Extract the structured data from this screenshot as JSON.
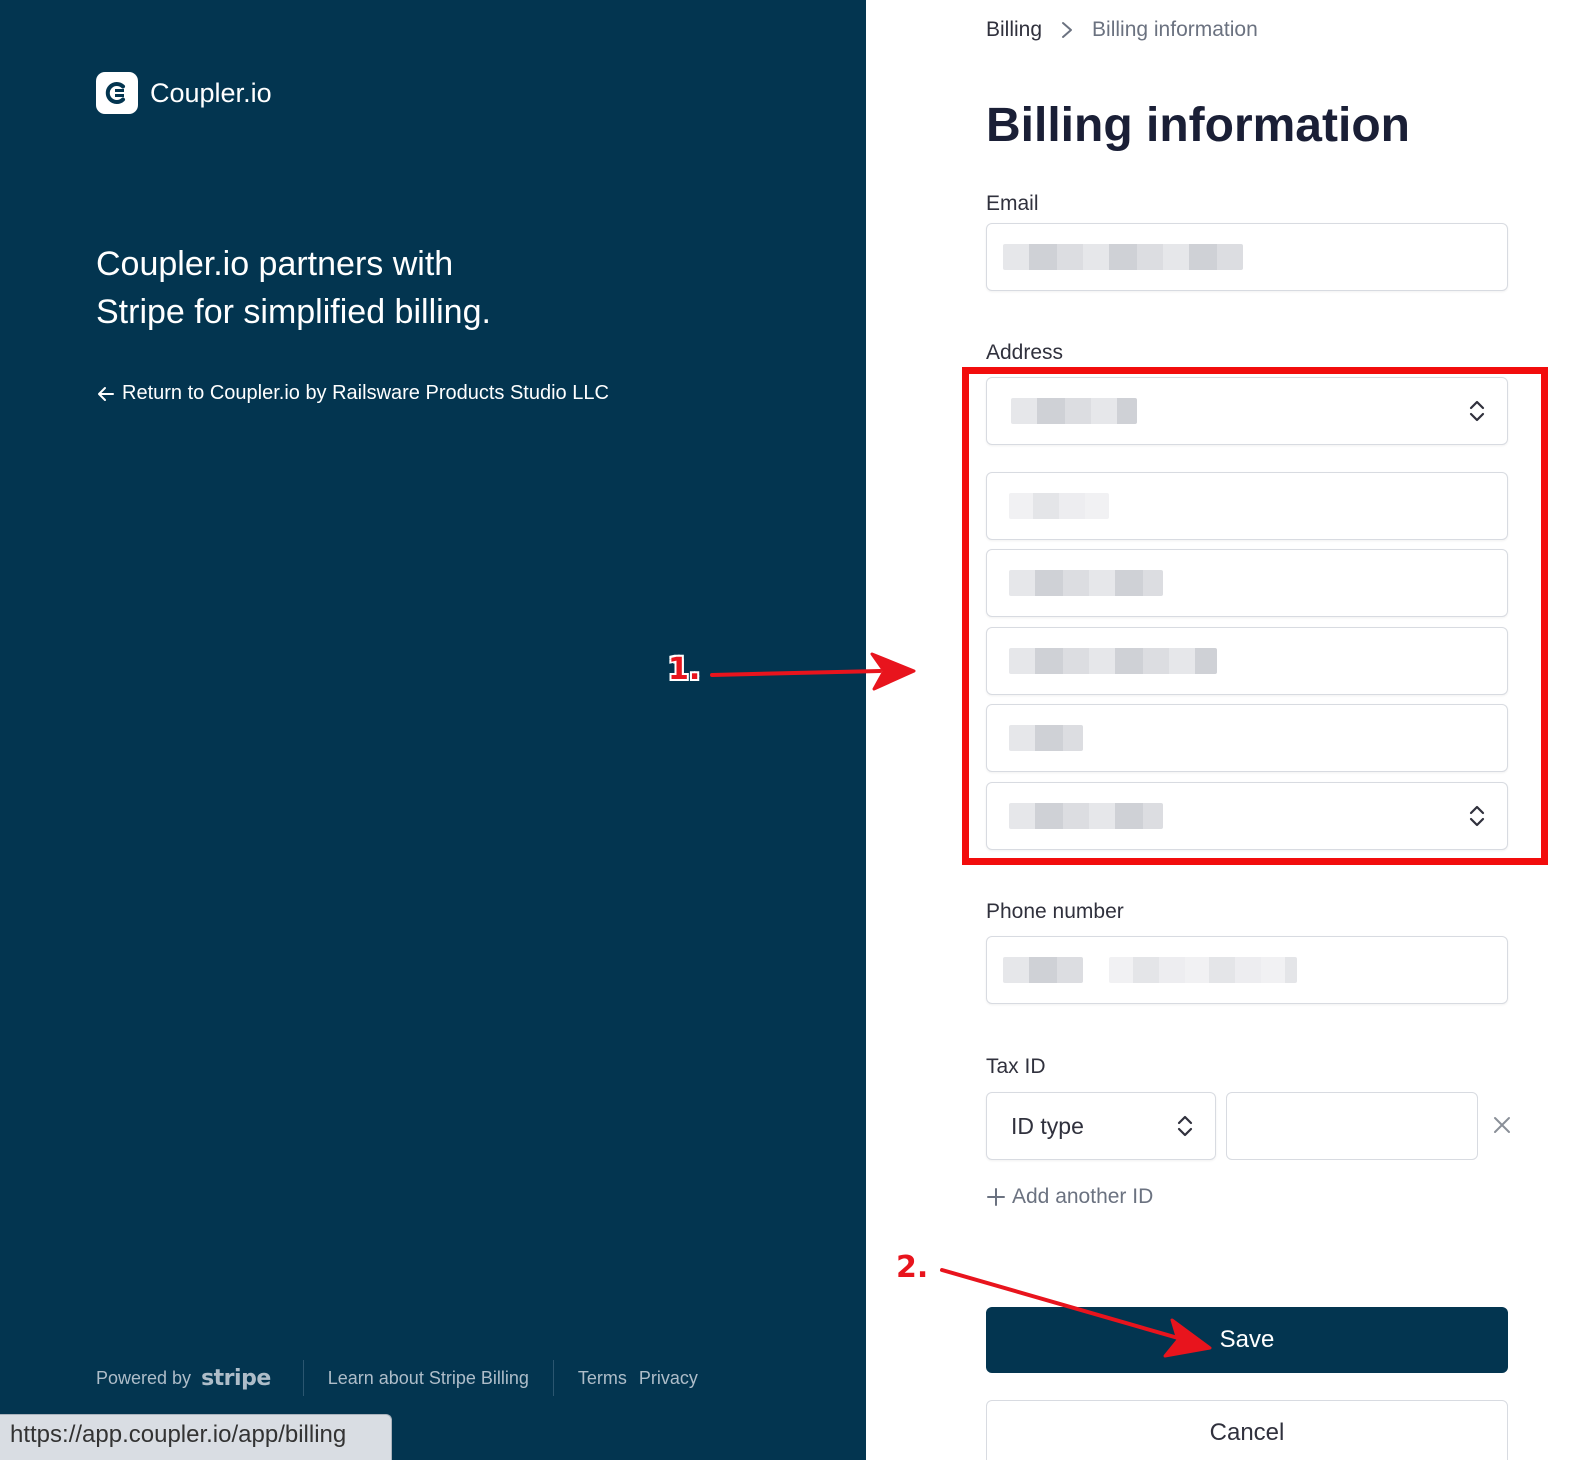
{
  "brand": {
    "name": "Coupler.io",
    "logo_icon": "coupler-logo-icon"
  },
  "left": {
    "headline_line1": "Coupler.io partners with",
    "headline_line2": "Stripe for simplified billing.",
    "return_link": "Return to Coupler.io by Railsware Products Studio LLC",
    "footer": {
      "powered_by": "Powered by",
      "stripe_word": "stripe",
      "learn": "Learn about Stripe Billing",
      "terms": "Terms",
      "privacy": "Privacy"
    }
  },
  "status_url": "https://app.coupler.io/app/billing",
  "breadcrumb": {
    "parent": "Billing",
    "current": "Billing information"
  },
  "page_title": "Billing information",
  "form": {
    "email_label": "Email",
    "address_label": "Address",
    "phone_label": "Phone number",
    "tax_label": "Tax ID",
    "tax_type_placeholder": "ID type",
    "add_another_id": "Add another ID",
    "save": "Save",
    "cancel": "Cancel"
  },
  "annotations": {
    "step1": "1.",
    "step2": "2."
  },
  "colors": {
    "panel": "#033550",
    "highlight": "#f20d0d",
    "primary_button": "#033550"
  }
}
